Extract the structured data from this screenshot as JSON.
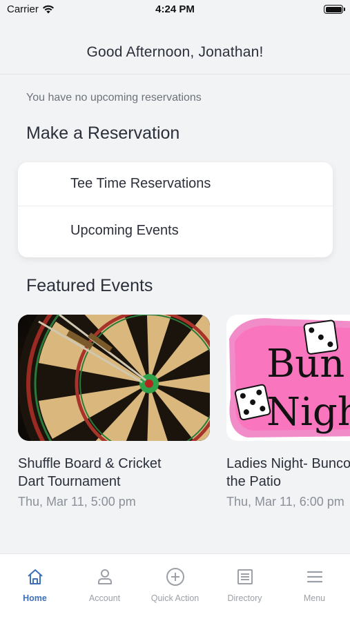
{
  "status_bar": {
    "carrier": "Carrier",
    "time": "4:24 PM"
  },
  "header": {
    "greeting": "Good Afternoon, Jonathan!"
  },
  "reservations": {
    "empty_message": "You have no upcoming reservations",
    "section_title": "Make a Reservation",
    "items": [
      {
        "label": "Tee Time Reservations"
      },
      {
        "label": "Upcoming Events"
      }
    ]
  },
  "featured": {
    "section_title": "Featured Events",
    "events": [
      {
        "title_line1": "Shuffle Board & Cricket",
        "title_line2": "Dart Tournament",
        "date": "Thu, Mar 11, 5:00 pm",
        "image": "dartboard-photo"
      },
      {
        "title_line1": "Ladies Night- Bunco on",
        "title_line2": "the Patio",
        "date": "Thu, Mar 11, 6:00 pm",
        "image": "bunco-night-logo",
        "image_text_line1": "Bunco",
        "image_text_line2": "Night"
      }
    ]
  },
  "tab_bar": {
    "tabs": [
      {
        "label": "Home",
        "icon": "home-icon",
        "active": true
      },
      {
        "label": "Account",
        "icon": "person-icon",
        "active": false
      },
      {
        "label": "Quick Action",
        "icon": "plus-circle-icon",
        "active": false
      },
      {
        "label": "Directory",
        "icon": "list-icon",
        "active": false
      },
      {
        "label": "Menu",
        "icon": "hamburger-icon",
        "active": false
      }
    ],
    "active_color": "#3e6fb8",
    "inactive_color": "#9ba0a8"
  }
}
